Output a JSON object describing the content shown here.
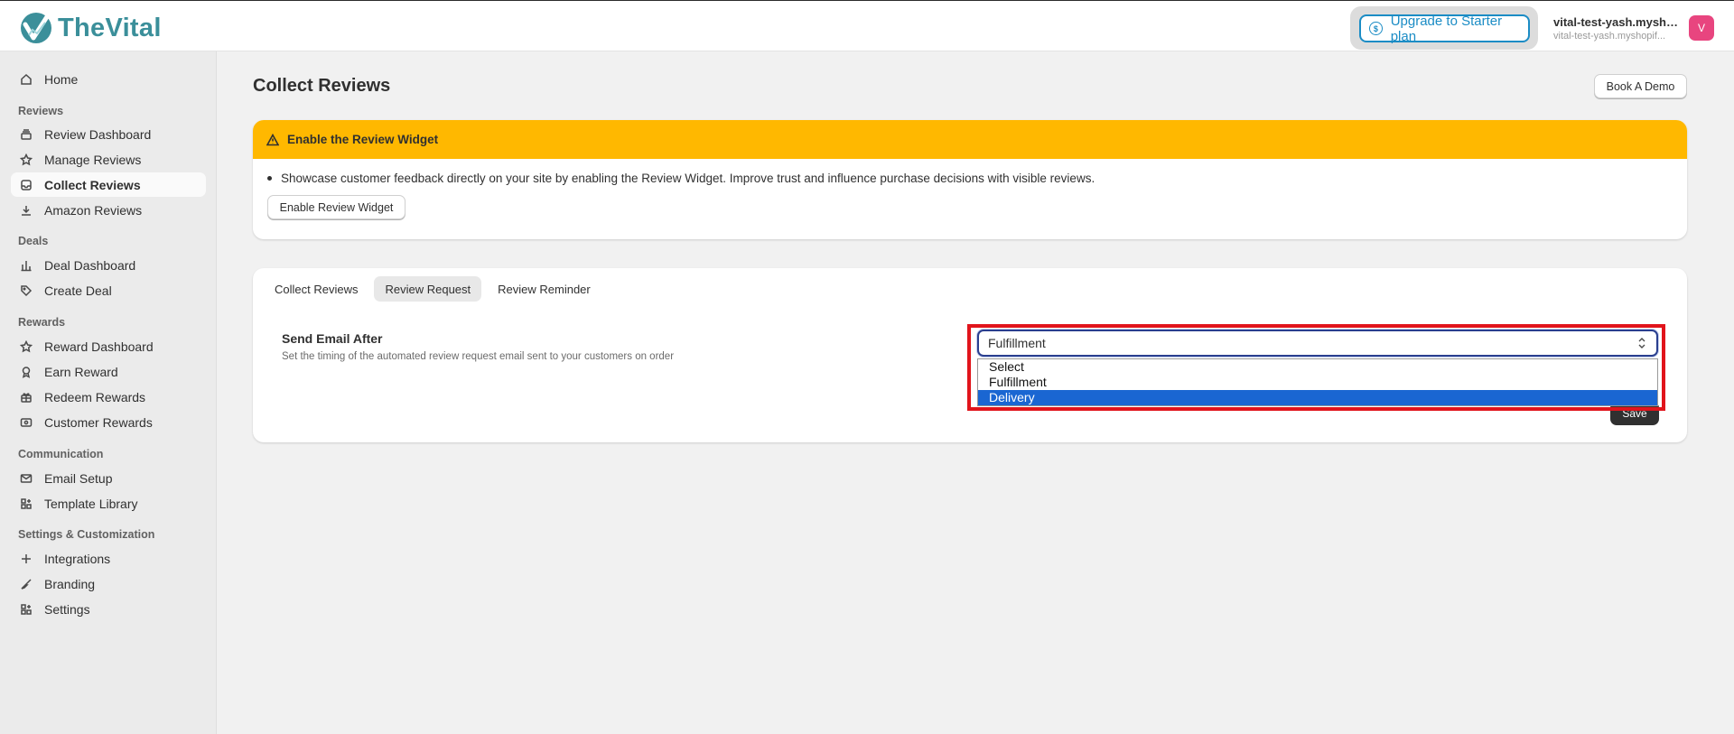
{
  "app": {
    "logo_text": "TheVital"
  },
  "topbar": {
    "upgrade_label": "Upgrade to Starter plan",
    "shop_name": "vital-test-yash.mysho...",
    "shop_domain": "vital-test-yash.myshopif...",
    "avatar_initial": "V"
  },
  "sidebar": {
    "home": "Home",
    "sections": {
      "reviews": "Reviews",
      "deals": "Deals",
      "rewards": "Rewards",
      "communication": "Communication",
      "settings": "Settings & Customization"
    },
    "items": {
      "review_dashboard": "Review Dashboard",
      "manage_reviews": "Manage Reviews",
      "collect_reviews": "Collect Reviews",
      "amazon_reviews": "Amazon Reviews",
      "deal_dashboard": "Deal Dashboard",
      "create_deal": "Create Deal",
      "reward_dashboard": "Reward Dashboard",
      "earn_reward": "Earn Reward",
      "redeem_rewards": "Redeem Rewards",
      "customer_rewards": "Customer Rewards",
      "email_setup": "Email Setup",
      "template_library": "Template Library",
      "integrations": "Integrations",
      "branding": "Branding",
      "settings": "Settings"
    }
  },
  "main": {
    "title": "Collect Reviews",
    "book_demo": "Book A Demo",
    "banner": {
      "title": "Enable the Review Widget",
      "text": "Showcase customer feedback directly on your site by enabling the Review Widget. Improve trust and influence purchase decisions with visible reviews.",
      "button": "Enable Review Widget",
      "color": "#ffb800"
    },
    "tabs": [
      "Collect Reviews",
      "Review Request",
      "Review Reminder"
    ],
    "field": {
      "label": "Send Email After",
      "help": "Set the timing of the automated review request email sent to your customers on order",
      "value": "Fulfillment",
      "options": [
        "Select",
        "Fulfillment",
        "Delivery"
      ],
      "highlighted_option": "Delivery"
    },
    "save_label": "Save"
  }
}
